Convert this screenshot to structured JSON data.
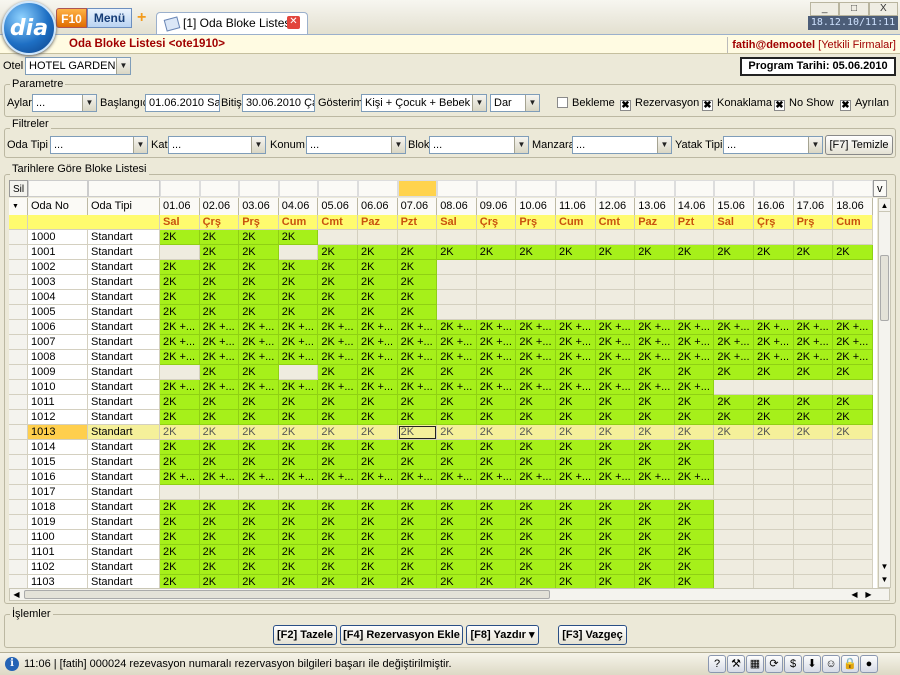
{
  "app": {
    "logo": "dia",
    "f10": "F10",
    "menu": "Menü",
    "tab_title": "[1] Oda Bloke Listesi",
    "clock": "18.12.10/11:11",
    "win_min": "_",
    "win_max": "□",
    "win_close": "X"
  },
  "header": {
    "title": "Oda Bloke Listesi <ote1910>",
    "user": "fatih@demootel",
    "firms": "[Yetkili Firmalar]"
  },
  "otel": {
    "label": "Otel",
    "value": "HOTEL GARDEN",
    "program_date": "Program Tarihi: 05.06.2010"
  },
  "parametre": {
    "title": "Parametre",
    "aylar_label": "Aylar",
    "aylar_value": "...",
    "baslangic_label": "Başlangıç",
    "baslangic_value": "01.06.2010 Sa",
    "bitis_label": "Bitiş",
    "bitis_value": "30.06.2010 Ça",
    "gosterim_label": "Gösterim",
    "gosterim_value": "Kişi + Çocuk + Bebek",
    "width_value": "Dar",
    "checks": [
      {
        "label": "Bekleme",
        "checked": false
      },
      {
        "label": "Rezervasyon",
        "checked": true
      },
      {
        "label": "Konaklama",
        "checked": true
      },
      {
        "label": "No Show",
        "checked": true
      },
      {
        "label": "Ayrılan",
        "checked": true
      }
    ]
  },
  "filtreler": {
    "title": "Filtreler",
    "fields": [
      {
        "label": "Oda Tipi",
        "value": "..."
      },
      {
        "label": "Kat",
        "value": "..."
      },
      {
        "label": "Konum",
        "value": "..."
      },
      {
        "label": "Blok",
        "value": "..."
      },
      {
        "label": "Manzara",
        "value": "..."
      },
      {
        "label": "Yatak Tipi",
        "value": "..."
      }
    ],
    "clear_button": "[F7] Temizle"
  },
  "list": {
    "title": "Tarihlere Göre Bloke Listesi",
    "sil": "Sil",
    "v_button": "v",
    "sort_glyph": "▼",
    "col_oda_no": "Oda No",
    "col_oda_tipi": "Oda Tipi",
    "dates": [
      "01.06",
      "02.06",
      "03.06",
      "04.06",
      "05.06",
      "06.06",
      "07.06",
      "08.06",
      "09.06",
      "10.06",
      "11.06",
      "12.06",
      "13.06",
      "14.06",
      "15.06",
      "16.06",
      "17.06",
      "18.06"
    ],
    "days": [
      "Sal",
      "Çrş",
      "Prş",
      "Cum",
      "Cmt",
      "Paz",
      "Pzt",
      "Sal",
      "Çrş",
      "Prş",
      "Cum",
      "Cmt",
      "Paz",
      "Pzt",
      "Sal",
      "Çrş",
      "Prş",
      "Cum"
    ],
    "rows": [
      {
        "no": "1000",
        "tip": "Standart",
        "c": "GGGGEEEEEEEEEEEEEE",
        "t": "2K|2K|2K|2K||||||||||||||"
      },
      {
        "no": "1001",
        "tip": "Standart",
        "c": "EGGEGGGGGGGGGGGGGG",
        "t": "|2K|2K||2K|2K|2K|2K|2K|2K|2K|2K|2K|2K|2K|2K|2K|2K"
      },
      {
        "no": "1002",
        "tip": "Standart",
        "c": "GGGGGGGEEEEEEEEEEE",
        "t": "2K|2K|2K|2K|2K|2K|2K|||||||||||"
      },
      {
        "no": "1003",
        "tip": "Standart",
        "c": "GGGGGGGEEEEEEEEEEE",
        "t": "2K|2K|2K|2K|2K|2K|2K|||||||||||"
      },
      {
        "no": "1004",
        "tip": "Standart",
        "c": "GGGGGGGEEEEEEEEEEE",
        "t": "2K|2K|2K|2K|2K|2K|2K|||||||||||"
      },
      {
        "no": "1005",
        "tip": "Standart",
        "c": "GGGGGGGEEEEEEEEEEE",
        "t": "2K|2K|2K|2K|2K|2K|2K|||||||||||"
      },
      {
        "no": "1006",
        "tip": "Standart",
        "c": "GGGGGGGGGGGGGGGGGG",
        "t": "2K +...|2K +...|2K +...|2K +...|2K +...|2K +...|2K +...|2K +...|2K +...|2K +...|2K +...|2K +...|2K +...|2K +...|2K +...|2K +...|2K +...|2K +..."
      },
      {
        "no": "1007",
        "tip": "Standart",
        "c": "GGGGGGGGGGGGGGGGGG",
        "t": "2K +...|2K +...|2K +...|2K +...|2K +...|2K +...|2K +...|2K +...|2K +...|2K +...|2K +...|2K +...|2K +...|2K +...|2K +...|2K +...|2K +...|2K +..."
      },
      {
        "no": "1008",
        "tip": "Standart",
        "c": "GGGGGGGGGGGGGGGGGG",
        "t": "2K +...|2K +...|2K +...|2K +...|2K +...|2K +...|2K +...|2K +...|2K +...|2K +...|2K +...|2K +...|2K +...|2K +...|2K +...|2K +...|2K +...|2K +..."
      },
      {
        "no": "1009",
        "tip": "Standart",
        "c": "EGGEGGGGGGGGGGGGGG",
        "t": "|2K|2K||2K|2K|2K|2K|2K|2K|2K|2K|2K|2K|2K|2K|2K|2K"
      },
      {
        "no": "1010",
        "tip": "Standart",
        "c": "GGGGGGGGGGGGGGEEEE",
        "t": "2K +...|2K +...|2K +...|2K +...|2K +...|2K +...|2K +...|2K +...|2K +...|2K +...|2K +...|2K +...|2K +...|2K +...||||"
      },
      {
        "no": "1011",
        "tip": "Standart",
        "c": "GGGGGGGGGGGGGGGGGG",
        "t": "2K|2K|2K|2K|2K|2K|2K|2K|2K|2K|2K|2K|2K|2K|2K|2K|2K|2K"
      },
      {
        "no": "1012",
        "tip": "Standart",
        "c": "GGGGGGGGGGGGGGGGGG",
        "t": "2K|2K|2K|2K|2K|2K|2K|2K|2K|2K|2K|2K|2K|2K|2K|2K|2K|2K"
      },
      {
        "no": "1013",
        "tip": "Standart",
        "c": "SSSSSSSSSSSSSSSSSS",
        "t": "2K|2K|2K|2K|2K|2K|2K|2K|2K|2K|2K|2K|2K|2K|2K|2K|2K|2K",
        "sel": true
      },
      {
        "no": "1014",
        "tip": "Standart",
        "c": "GGGGGGGGGGGGGGEEEE",
        "t": "2K|2K|2K|2K|2K|2K|2K|2K|2K|2K|2K|2K|2K|2K||||"
      },
      {
        "no": "1015",
        "tip": "Standart",
        "c": "GGGGGGGGGGGGGGEEEE",
        "t": "2K|2K|2K|2K|2K|2K|2K|2K|2K|2K|2K|2K|2K|2K||||"
      },
      {
        "no": "1016",
        "tip": "Standart",
        "c": "GGGGGGGGGGGGGGEEEE",
        "t": "2K +...|2K +...|2K +...|2K +...|2K +...|2K +...|2K +...|2K +...|2K +...|2K +...|2K +...|2K +...|2K +...|2K +...||||"
      },
      {
        "no": "1017",
        "tip": "Standart",
        "c": "EEEEEEEEEEEEEEEEEE",
        "t": "|||||||||||||||||"
      },
      {
        "no": "1018",
        "tip": "Standart",
        "c": "GGGGGGGGGGGGGGEEEE",
        "t": "2K|2K|2K|2K|2K|2K|2K|2K|2K|2K|2K|2K|2K|2K||||"
      },
      {
        "no": "1019",
        "tip": "Standart",
        "c": "GGGGGGGGGGGGGGEEEE",
        "t": "2K|2K|2K|2K|2K|2K|2K|2K|2K|2K|2K|2K|2K|2K||||"
      },
      {
        "no": "1100",
        "tip": "Standart",
        "c": "GGGGGGGGGGGGGGEEEE",
        "t": "2K|2K|2K|2K|2K|2K|2K|2K|2K|2K|2K|2K|2K|2K||||"
      },
      {
        "no": "1101",
        "tip": "Standart",
        "c": "GGGGGGGGGGGGGGEEEE",
        "t": "2K|2K|2K|2K|2K|2K|2K|2K|2K|2K|2K|2K|2K|2K||||"
      },
      {
        "no": "1102",
        "tip": "Standart",
        "c": "GGGGGGGGGGGGGGEEEE",
        "t": "2K|2K|2K|2K|2K|2K|2K|2K|2K|2K|2K|2K|2K|2K||||"
      },
      {
        "no": "1103",
        "tip": "Standart",
        "c": "GGGGGGGGGGGGGGEEEE",
        "t": "2K|2K|2K|2K|2K|2K|2K|2K|2K|2K|2K|2K|2K|2K||||"
      }
    ]
  },
  "islemler": {
    "title": "İşlemler",
    "tazele": "[F2] Tazele",
    "rez_ekle": "[F4] Rezervasyon Ekle",
    "yazdir": "[F8] Yazdır ▾",
    "vazgec": "[F3] Vazgeç"
  },
  "status": {
    "info_glyph": "i",
    "text": "11:06 | [fatih] 000024 rezevasyon numaralı rezervasyon bilgileri başarı ile değiştirilmiştir.",
    "icons": [
      "help-icon",
      "tools-icon",
      "calculator-icon",
      "refresh-icon",
      "money-icon",
      "download-icon",
      "smiley-icon",
      "lock-icon",
      "online-icon"
    ],
    "icon_glyphs": [
      "?",
      "⚒",
      "▦",
      "⟳",
      "$",
      "⬇",
      "☺",
      "🔒",
      "●"
    ]
  },
  "colors": {
    "green": "#a6f01a",
    "empty": "#efece0",
    "selected": "#f5f09a",
    "day_header_bg": "#fffb6e",
    "day_text": "#c8520e",
    "accent_red": "#a00000"
  }
}
